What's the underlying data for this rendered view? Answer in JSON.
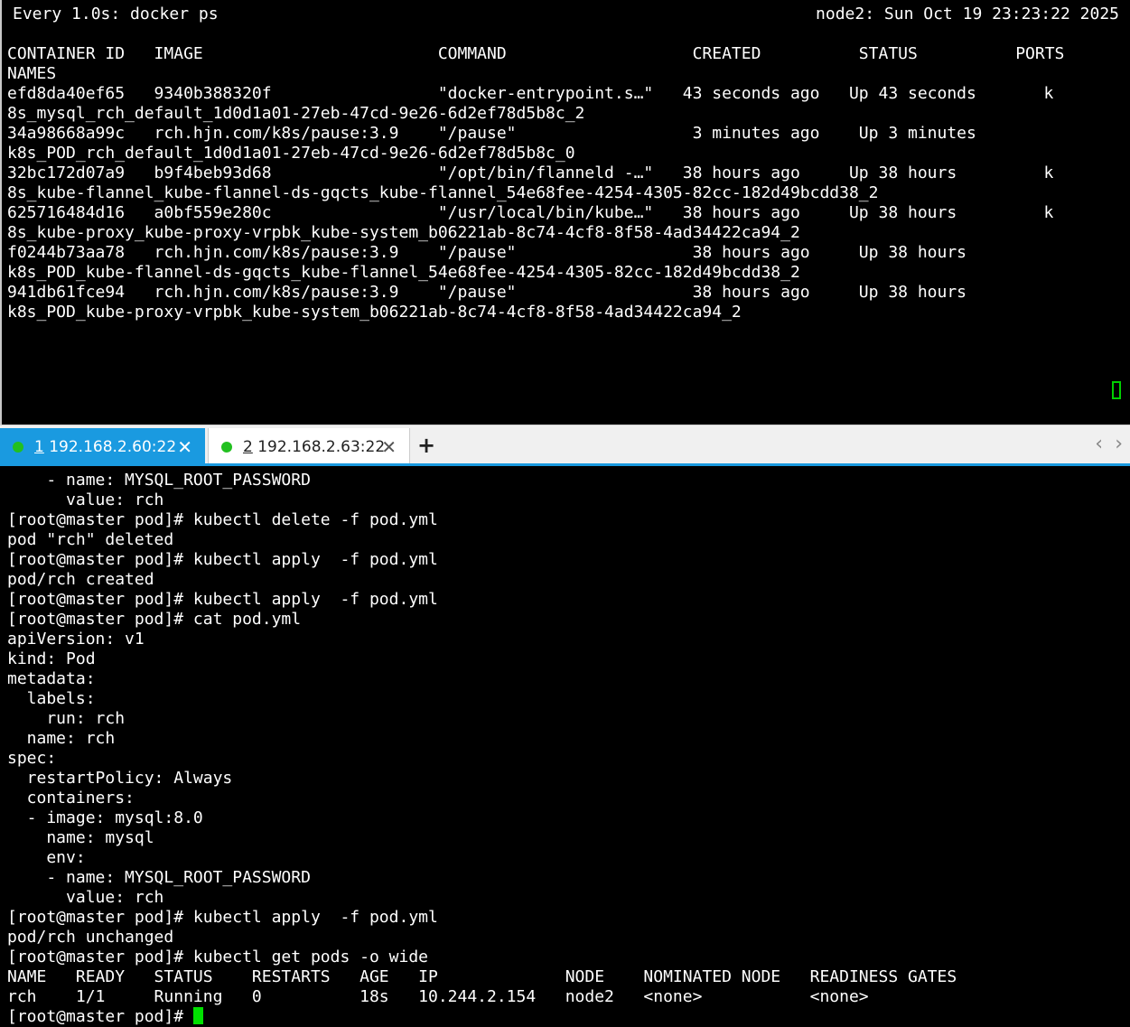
{
  "top_terminal": {
    "watch_header": "Every 1.0s: docker ps",
    "host_time": "node2: Sun Oct 19 23:23:22 2025",
    "header_line1": "CONTAINER ID   IMAGE                        COMMAND                   CREATED          STATUS          PORTS",
    "header_line2": "NAMES",
    "rows": [
      {
        "line1": "efd8da40ef65   9340b388320f                 \"docker-entrypoint.s…\"   43 seconds ago   Up 43 seconds",
        "wrap": "k",
        "line2": "8s_mysql_rch_default_1d0d1a01-27eb-47cd-9e26-6d2ef78d5b8c_2"
      },
      {
        "line1": "34a98668a99c   rch.hjn.com/k8s/pause:3.9    \"/pause\"                  3 minutes ago    Up 3 minutes",
        "wrap": "",
        "line2": "k8s_POD_rch_default_1d0d1a01-27eb-47cd-9e26-6d2ef78d5b8c_0"
      },
      {
        "line1": "32bc172d07a9   b9f4beb93d68                 \"/opt/bin/flanneld -…\"   38 hours ago     Up 38 hours",
        "wrap": "k",
        "line2": "8s_kube-flannel_kube-flannel-ds-gqcts_kube-flannel_54e68fee-4254-4305-82cc-182d49bcdd38_2"
      },
      {
        "line1": "625716484d16   a0bf559e280c                 \"/usr/local/bin/kube…\"   38 hours ago     Up 38 hours",
        "wrap": "k",
        "line2": "8s_kube-proxy_kube-proxy-vrpbk_kube-system_b06221ab-8c74-4cf8-8f58-4ad34422ca94_2"
      },
      {
        "line1": "f0244b73aa78   rch.hjn.com/k8s/pause:3.9    \"/pause\"                  38 hours ago     Up 38 hours",
        "wrap": "",
        "line2": "k8s_POD_kube-flannel-ds-gqcts_kube-flannel_54e68fee-4254-4305-82cc-182d49bcdd38_2"
      },
      {
        "line1": "941db61fce94   rch.hjn.com/k8s/pause:3.9    \"/pause\"                  38 hours ago     Up 38 hours",
        "wrap": "",
        "line2": "k8s_POD_kube-proxy-vrpbk_kube-system_b06221ab-8c74-4cf8-8f58-4ad34422ca94_2"
      }
    ]
  },
  "tabs": [
    {
      "num": "1",
      "host": " 192.168.2.60:22",
      "close": "✕"
    },
    {
      "num": "2",
      "host": " 192.168.2.63:22",
      "close": "✕"
    }
  ],
  "tabbar": {
    "add": "+",
    "prev": "‹",
    "next": "›"
  },
  "bottom_terminal": {
    "lines": [
      "    - name: MYSQL_ROOT_PASSWORD",
      "      value: rch",
      "[root@master pod]# kubectl delete -f pod.yml",
      "pod \"rch\" deleted",
      "[root@master pod]# kubectl apply  -f pod.yml",
      "pod/rch created",
      "[root@master pod]# kubectl apply  -f pod.yml",
      "[root@master pod]# cat pod.yml",
      "apiVersion: v1",
      "kind: Pod",
      "metadata:",
      "  labels:",
      "    run: rch",
      "  name: rch",
      "spec:",
      "  restartPolicy: Always",
      "  containers:",
      "  - image: mysql:8.0",
      "    name: mysql",
      "    env:",
      "    - name: MYSQL_ROOT_PASSWORD",
      "      value: rch",
      "[root@master pod]# kubectl apply  -f pod.yml",
      "pod/rch unchanged",
      "[root@master pod]# kubectl get pods -o wide",
      "NAME   READY   STATUS    RESTARTS   AGE   IP             NODE    NOMINATED NODE   READINESS GATES",
      "rch    1/1     Running   0          18s   10.244.2.154   node2   <none>           <none>"
    ],
    "prompt": "[root@master pod]# "
  }
}
